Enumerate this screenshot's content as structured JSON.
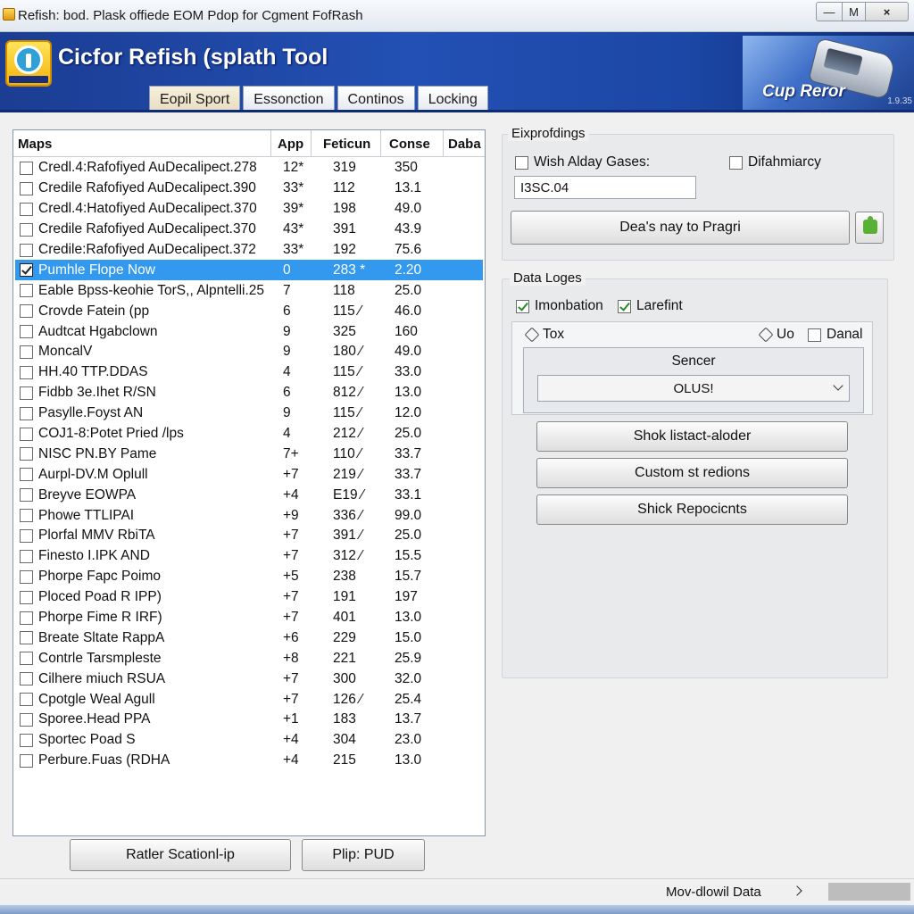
{
  "window": {
    "title": "Refish: bod. Plask offiede EOM Pdop for Cgment FofRash",
    "min_label": "—",
    "max_label": "M",
    "close_label": "×"
  },
  "header": {
    "app_title": "Cicfor Refish (splath Tool",
    "brand": "Cup Reror",
    "version": "1.9.35",
    "tabs": [
      "Eopil Sport",
      "Essonction",
      "Continos",
      "Locking"
    ],
    "active_tab": 0
  },
  "list": {
    "columns": [
      "Maps",
      "App",
      "Feticun",
      "Conse",
      "Daba"
    ],
    "rows": [
      {
        "name": "Credl.4:Rafofiyed AuDecalipect.278",
        "app": "12*",
        "fet": "319",
        "con": "350",
        "checked": false,
        "selected": false
      },
      {
        "name": "Credile Rafofiyed AuDecalipect.390",
        "app": "33*",
        "fet": "112",
        "con": "13.1",
        "checked": false,
        "selected": false
      },
      {
        "name": "Credl.4:Hatofiyed AuDecalipect.370",
        "app": "39*",
        "fet": "198",
        "con": "49.0",
        "checked": false,
        "selected": false
      },
      {
        "name": "Credile Rafofiyed AuDecalipect.370",
        "app": "43*",
        "fet": "391",
        "con": "43.9",
        "checked": false,
        "selected": false
      },
      {
        "name": "Credile:Rafofiyed AuDecalipect.372",
        "app": "33*",
        "fet": "192",
        "con": "75.6",
        "checked": false,
        "selected": false
      },
      {
        "name": "Pumhle Flope Now",
        "app": "0",
        "fet": "283 *",
        "con": "2.20",
        "checked": true,
        "selected": true
      },
      {
        "name": "Eable Bpss-keohie TorS,, Alpntelli.25",
        "app": "7",
        "fet": "118",
        "con": "25.0",
        "checked": false,
        "selected": false
      },
      {
        "name": "Crovde Fatein (pp",
        "app": "6",
        "fet": "115 ⁄",
        "con": "46.0",
        "checked": false,
        "selected": false
      },
      {
        "name": "Audtcat Hgabclown",
        "app": "9",
        "fet": "325",
        "con": "160",
        "checked": false,
        "selected": false
      },
      {
        "name": "MoncalV",
        "app": "9",
        "fet": "180 ⁄",
        "con": "49.0",
        "checked": false,
        "selected": false
      },
      {
        "name": "HH.40 TTP.DDAS",
        "app": "4",
        "fet": "115 ⁄",
        "con": "33.0",
        "checked": false,
        "selected": false
      },
      {
        "name": "Fidbb 3e.Ihet R/SN",
        "app": "6",
        "fet": "812 ⁄",
        "con": "13.0",
        "checked": false,
        "selected": false
      },
      {
        "name": "Pasylle.Foyst AN",
        "app": "9",
        "fet": "115 ⁄",
        "con": "12.0",
        "checked": false,
        "selected": false
      },
      {
        "name": "COJ1-8:Potet Pried /lps",
        "app": "4",
        "fet": "212 ⁄",
        "con": "25.0",
        "checked": false,
        "selected": false
      },
      {
        "name": "NISC PN.BY Pame",
        "app": "7+",
        "fet": "110 ⁄",
        "con": "33.7",
        "checked": false,
        "selected": false
      },
      {
        "name": "Aurpl-DV.M Oplull",
        "app": "+7",
        "fet": "219 ⁄",
        "con": "33.7",
        "checked": false,
        "selected": false
      },
      {
        "name": "Breyve EOWPA",
        "app": "+4",
        "fet": "E19 ⁄",
        "con": "33.1",
        "checked": false,
        "selected": false
      },
      {
        "name": "Phowe TTLIPAI",
        "app": "+9",
        "fet": "336 ⁄",
        "con": "99.0",
        "checked": false,
        "selected": false
      },
      {
        "name": "Plorfal MMV RbiTA",
        "app": "+7",
        "fet": "391 ⁄",
        "con": "25.0",
        "checked": false,
        "selected": false
      },
      {
        "name": "Finesto I.IPK AND",
        "app": "+7",
        "fet": "312 ⁄",
        "con": "15.5",
        "checked": false,
        "selected": false
      },
      {
        "name": "Phorpe Fapc Poimo",
        "app": "+5",
        "fet": "238",
        "con": "15.7",
        "checked": false,
        "selected": false
      },
      {
        "name": "Ploced Poad R IPP)",
        "app": "+7",
        "fet": "191",
        "con": "197",
        "checked": false,
        "selected": false
      },
      {
        "name": "Phorpe Fime R IRF)",
        "app": "+7",
        "fet": "401",
        "con": "13.0",
        "checked": false,
        "selected": false
      },
      {
        "name": "Breate Sltate RappA",
        "app": "+6",
        "fet": "229",
        "con": "15.0",
        "checked": false,
        "selected": false
      },
      {
        "name": "Contrle Tarsmpleste",
        "app": "+8",
        "fet": "221",
        "con": "25.9",
        "checked": false,
        "selected": false
      },
      {
        "name": "Cilhere miuch RSUA",
        "app": "+7",
        "fet": "300",
        "con": "32.0",
        "checked": false,
        "selected": false
      },
      {
        "name": "Cpotgle Weal Agull",
        "app": "+7",
        "fet": "126 ⁄",
        "con": "25.4",
        "checked": false,
        "selected": false
      },
      {
        "name": "Sporee.Head PPA",
        "app": "+1",
        "fet": "183",
        "con": "13.7",
        "checked": false,
        "selected": false
      },
      {
        "name": "Sportec Poad S",
        "app": "+4",
        "fet": "304",
        "con": "23.0",
        "checked": false,
        "selected": false
      },
      {
        "name": "Perbure.Fuas (RDHA",
        "app": "+4",
        "fet": "215",
        "con": "13.0",
        "checked": false,
        "selected": false
      }
    ],
    "btn_left": "Ratler Scationl-ip",
    "btn_right": "Plip: PUD"
  },
  "options": {
    "group_title": "Eixprofdings",
    "chk1": "Wish Alday Gases:",
    "chk2": "Difahmiarcy",
    "input_value": "I3SC.04",
    "action_button": "Dea's nay to Pragri"
  },
  "data_logs": {
    "group_title": "Data Loges",
    "chk1": "Imonbation",
    "chk2": "Larefint",
    "tox_label": "Tox",
    "uo_label": "Uo",
    "danal_label": "Danal",
    "sencer_label": "Sencer",
    "dropdown_value": "OLUS!",
    "btn1": "Shok listact-aloder",
    "btn2": "Custom st redions",
    "btn3": "Shick Repocicnts"
  },
  "status": {
    "text": "Mov-dlowil Data"
  }
}
